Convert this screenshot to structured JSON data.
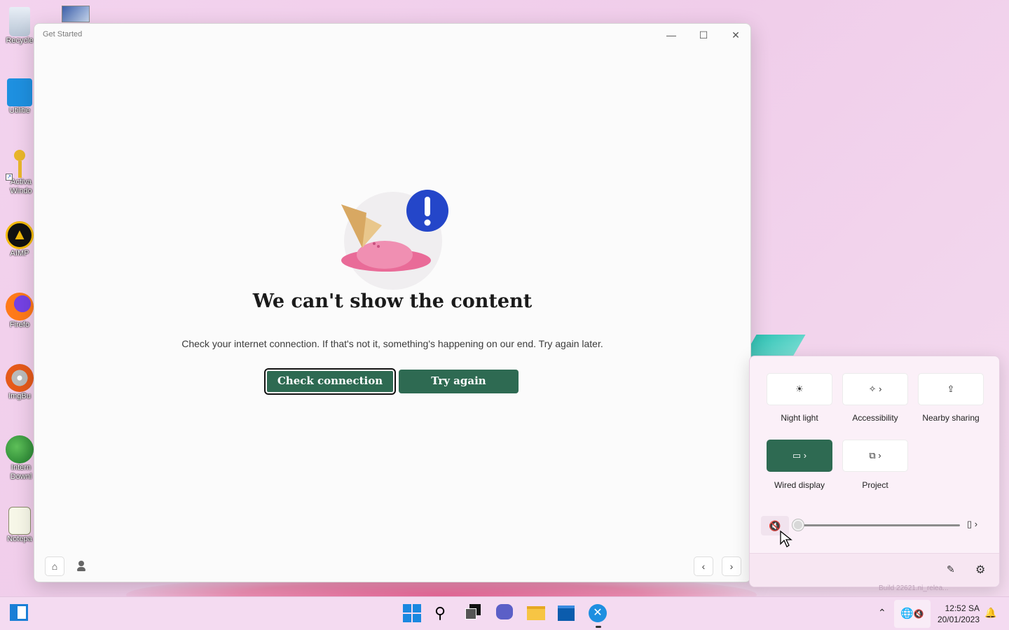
{
  "desktop": {
    "icons": [
      {
        "label": "Recycle",
        "icon": "recycle-bin-icon"
      },
      {
        "label": "Utilitie",
        "icon": "folder-icon"
      },
      {
        "label": "Activa Windo",
        "icon": "key-icon"
      },
      {
        "label": "AIMP",
        "icon": "aimp-icon"
      },
      {
        "label": "Firefo",
        "icon": "firefox-icon"
      },
      {
        "label": "ImgBu",
        "icon": "imgburn-icon"
      },
      {
        "label": "Intern Downl",
        "icon": "idm-icon"
      },
      {
        "label": "Notepa",
        "icon": "notepad-icon"
      }
    ],
    "watermark": "Build 22621.ni_relea..."
  },
  "window": {
    "title": "Get Started",
    "headline": "We can't show the content",
    "message": "Check your internet connection. If that's not it, something's happening on our end. Try again later.",
    "primary_button": "Check connection",
    "secondary_button": "Try again"
  },
  "quick_settings": {
    "tiles": [
      {
        "label": "Night light",
        "icon": "night-light-icon",
        "active": false,
        "chevron": false
      },
      {
        "label": "Accessibility",
        "icon": "accessibility-icon",
        "active": false,
        "chevron": true
      },
      {
        "label": "Nearby sharing",
        "icon": "share-icon",
        "active": false,
        "chevron": false
      },
      {
        "label": "Wired display",
        "icon": "cast-icon",
        "active": true,
        "chevron": true
      },
      {
        "label": "Project",
        "icon": "project-icon",
        "active": false,
        "chevron": true
      }
    ],
    "volume_level": 0,
    "volume_muted": true
  },
  "taskbar": {
    "time": "12:52 SA",
    "date": "20/01/2023"
  },
  "colors": {
    "accent_green": "#2e6a52",
    "desktop_pink": "#f0cdea",
    "window_bg": "#fbfbfb"
  }
}
